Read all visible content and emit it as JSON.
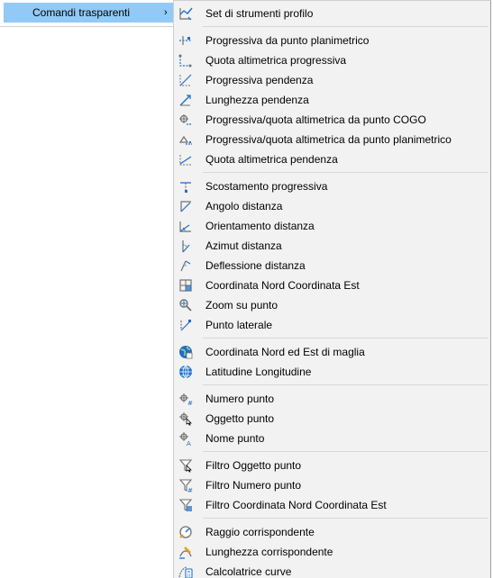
{
  "parent_menu": {
    "item_label": "Comandi trasparenti",
    "arrow": "›"
  },
  "submenu": {
    "groups": [
      [
        {
          "label": "Set di strumenti profilo",
          "icon": "profile-toolset-icon"
        }
      ],
      [
        {
          "label": "Progressiva da punto planimetrico",
          "icon": "station-from-plan-point-icon"
        },
        {
          "label": "Quota altimetrica progressiva",
          "icon": "station-elevation-icon"
        },
        {
          "label": "Progressiva pendenza",
          "icon": "station-grade-icon"
        },
        {
          "label": "Lunghezza pendenza",
          "icon": "grade-length-icon"
        },
        {
          "label": "Progressiva/quota altimetrica da punto COGO",
          "icon": "station-elevation-cogo-point-icon"
        },
        {
          "label": "Progressiva/quota altimetrica da punto planimetrico",
          "icon": "station-elevation-plan-point-icon"
        },
        {
          "label": "Quota altimetrica pendenza",
          "icon": "grade-elevation-icon"
        }
      ],
      [
        {
          "label": "Scostamento progressiva",
          "icon": "station-offset-icon"
        },
        {
          "label": "Angolo distanza",
          "icon": "angle-distance-icon"
        },
        {
          "label": "Orientamento distanza",
          "icon": "bearing-distance-icon"
        },
        {
          "label": "Azimut distanza",
          "icon": "azimuth-distance-icon"
        },
        {
          "label": "Deflessione distanza",
          "icon": "deflection-distance-icon"
        },
        {
          "label": "Coordinata Nord Coordinata Est",
          "icon": "northing-easting-icon"
        },
        {
          "label": "Zoom su punto",
          "icon": "zoom-to-point-icon"
        },
        {
          "label": "Punto laterale",
          "icon": "side-shot-point-icon"
        }
      ],
      [
        {
          "label": "Coordinata Nord ed Est di maglia",
          "icon": "grid-northing-easting-icon"
        },
        {
          "label": "Latitudine Longitudine",
          "icon": "latitude-longitude-icon"
        }
      ],
      [
        {
          "label": "Numero punto",
          "icon": "point-number-icon"
        },
        {
          "label": "Oggetto punto",
          "icon": "point-object-icon"
        },
        {
          "label": "Nome punto",
          "icon": "point-name-icon"
        }
      ],
      [
        {
          "label": "Filtro Oggetto punto",
          "icon": "point-object-filter-icon"
        },
        {
          "label": "Filtro Numero punto",
          "icon": "point-number-filter-icon"
        },
        {
          "label": "Filtro Coordinata Nord Coordinata Est",
          "icon": "northing-easting-filter-icon"
        }
      ],
      [
        {
          "label": "Raggio corrispondente",
          "icon": "match-radius-icon"
        },
        {
          "label": "Lunghezza corrispondente",
          "icon": "match-length-icon"
        },
        {
          "label": "Calcolatrice curve",
          "icon": "curve-calculator-icon"
        }
      ]
    ]
  },
  "colors": {
    "highlight": "#91c9f7",
    "menu_bg": "#f2f2f2",
    "icon_blue": "#1e6fc9",
    "icon_gray": "#707070"
  }
}
